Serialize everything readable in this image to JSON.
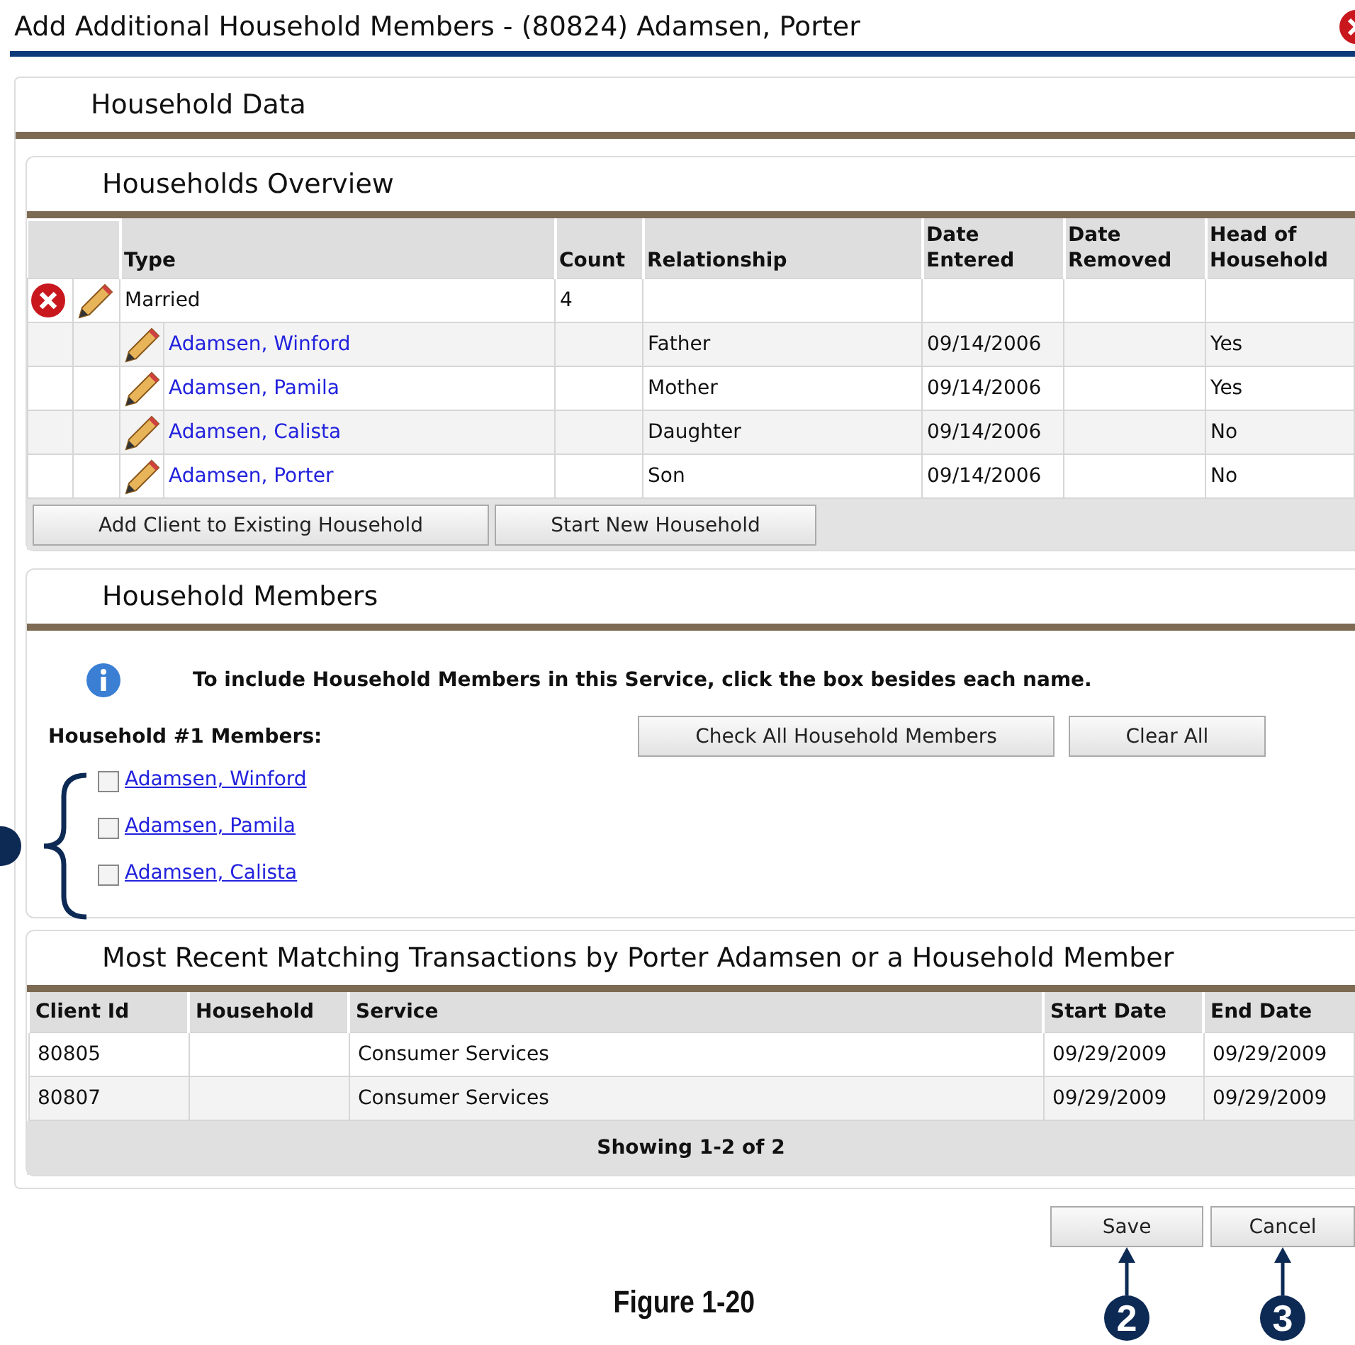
{
  "window": {
    "title": "Add Additional Household Members - (80824) Adamsen, Porter"
  },
  "household_data": {
    "title": "Household Data"
  },
  "households_overview": {
    "title": "Households Overview",
    "columns": [
      "Type",
      "Count",
      "Relationship",
      "Date Entered",
      "Date Removed",
      "Head of Household"
    ],
    "household": {
      "type": "Married",
      "count": "4"
    },
    "members": [
      {
        "name": "Adamsen, Winford",
        "relationship": "Father",
        "date_entered": "09/14/2006",
        "head_of_household": "Yes"
      },
      {
        "name": "Adamsen, Pamila",
        "relationship": "Mother",
        "date_entered": "09/14/2006",
        "head_of_household": "Yes"
      },
      {
        "name": "Adamsen, Calista",
        "relationship": "Daughter",
        "date_entered": "09/14/2006",
        "head_of_household": "No"
      },
      {
        "name": "Adamsen, Porter",
        "relationship": "Son",
        "date_entered": "09/14/2006",
        "head_of_household": "No"
      }
    ],
    "buttons": [
      "Add Client to Existing Household",
      "Start New Household"
    ]
  },
  "household_members": {
    "title": "Household Members",
    "info": "To include Household Members in this Service, click the box besides each name.",
    "group_label": "Household #1 Members:",
    "buttons": [
      "Check All Household Members",
      "Clear All"
    ],
    "members": [
      {
        "name": "Adamsen, Winford",
        "checked": false
      },
      {
        "name": "Adamsen, Pamila",
        "checked": false
      },
      {
        "name": "Adamsen, Calista",
        "checked": false
      }
    ]
  },
  "transactions": {
    "title": "Most Recent Matching Transactions by Porter Adamsen or a Household Member",
    "columns": [
      "Client Id",
      "Household",
      "Service",
      "Start Date",
      "End Date"
    ],
    "rows": [
      [
        "80805",
        "",
        "Consumer Services",
        "09/29/2009",
        "09/29/2009"
      ],
      [
        "80807",
        "",
        "Consumer Services",
        "09/29/2009",
        "09/29/2009"
      ]
    ],
    "footer": "Showing 1-2 of 2"
  },
  "actions": [
    {
      "label": "Save",
      "callout": "2"
    },
    {
      "label": "Cancel",
      "callout": "3"
    }
  ],
  "figure_caption": "Figure 1-20"
}
